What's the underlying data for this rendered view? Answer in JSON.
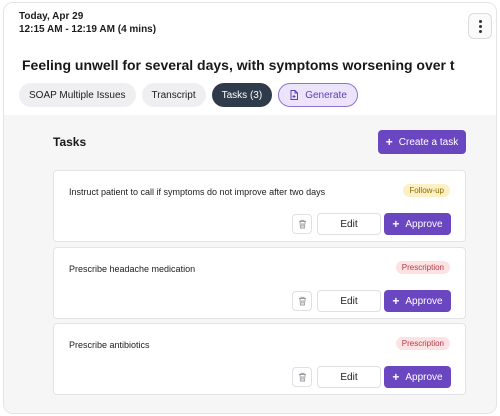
{
  "encounter": {
    "date": "Today, Apr 29",
    "time_range": "12:15 AM - 12:19 AM (4 mins)",
    "title": "Feeling unwell for several days, with symptoms worsening over t"
  },
  "tabs": [
    {
      "label": "SOAP Multiple Issues",
      "active": false
    },
    {
      "label": "Transcript",
      "active": false
    },
    {
      "label": "Tasks  (3)",
      "active": true
    },
    {
      "label": "Generate",
      "icon": "generate-document-icon"
    }
  ],
  "tasks_section": {
    "title": "Tasks",
    "create_label": "Create a task",
    "create_icon": "plus-icon"
  },
  "tasks": [
    {
      "text": "Instruct patient to call if symptoms do not improve after two days",
      "badge": "Follow-up",
      "badge_color": "#fdf0c4",
      "edit_label": "Edit",
      "approve_label": "Approve"
    },
    {
      "text": "Prescribe headache medication",
      "badge": "Prescription",
      "badge_color": "#fde2e4",
      "edit_label": "Edit",
      "approve_label": "Approve"
    },
    {
      "text": "Prescribe antibiotics",
      "badge": "Prescription",
      "badge_color": "#fde2e4",
      "edit_label": "Edit",
      "approve_label": "Approve"
    }
  ],
  "colors": {
    "accent": "#6b46c1",
    "active_tab": "#2f3a4b"
  }
}
